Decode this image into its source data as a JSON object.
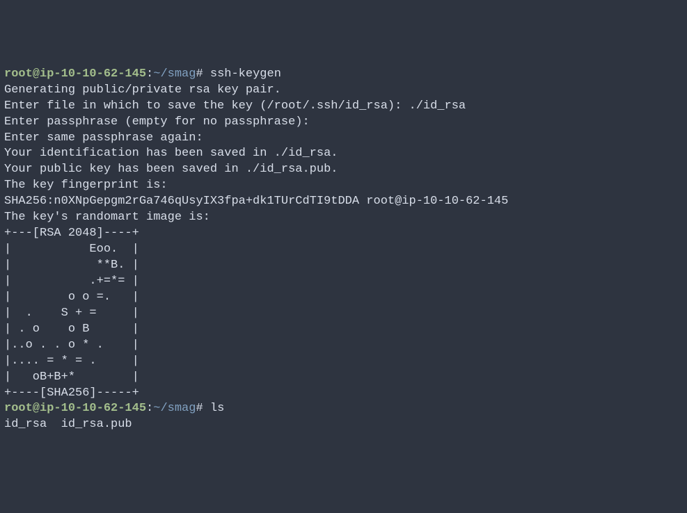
{
  "prompt1": {
    "user": "root@ip-10-10-62-145",
    "colon": ":",
    "path": "~/smag",
    "hash": "# ",
    "cmd": "ssh-keygen"
  },
  "output": {
    "l1": "Generating public/private rsa key pair.",
    "l2": "Enter file in which to save the key (/root/.ssh/id_rsa): ./id_rsa",
    "l3": "Enter passphrase (empty for no passphrase):",
    "l4": "Enter same passphrase again:",
    "l5": "Your identification has been saved in ./id_rsa.",
    "l6": "Your public key has been saved in ./id_rsa.pub.",
    "l7": "The key fingerprint is:",
    "l8": "SHA256:n0XNpGepgm2rGa746qUsyIX3fpa+dk1TUrCdTI9tDDA root@ip-10-10-62-145",
    "l9": "The key's randomart image is:",
    "art1": "+---[RSA 2048]----+",
    "art2": "|           Eoo.  |",
    "art3": "|            **B. |",
    "art4": "|           .+=*= |",
    "art5": "|        o o =.   |",
    "art6": "|  .    S + =     |",
    "art7": "| . o    o B      |",
    "art8": "|..o . . o * .    |",
    "art9": "|.... = * = .     |",
    "art10": "|   oB+B+*        |",
    "art11": "+----[SHA256]-----+"
  },
  "prompt2": {
    "user": "root@ip-10-10-62-145",
    "colon": ":",
    "path": "~/smag",
    "hash": "# ",
    "cmd": "ls"
  },
  "lsout": "id_rsa  id_rsa.pub"
}
